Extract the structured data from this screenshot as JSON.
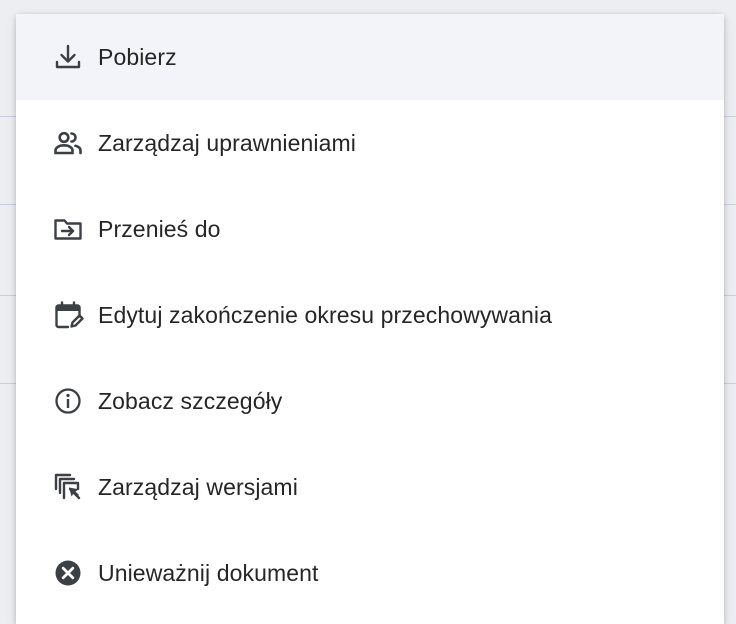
{
  "menu": {
    "items": [
      {
        "label": "Pobierz",
        "icon": "download-icon",
        "highlighted": true
      },
      {
        "label": "Zarządzaj uprawnieniami",
        "icon": "people-icon"
      },
      {
        "label": "Przenieś do",
        "icon": "move-to-folder-icon"
      },
      {
        "label": "Edytuj zakończenie okresu przechowywania",
        "icon": "calendar-edit-icon"
      },
      {
        "label": "Zobacz szczegóły",
        "icon": "info-icon"
      },
      {
        "label": "Zarządzaj wersjami",
        "icon": "versions-icon"
      },
      {
        "label": "Unieważnij dokument",
        "icon": "cancel-circle-icon"
      }
    ]
  },
  "colors": {
    "text": "#262626",
    "icon": "#3c3f44",
    "highlight": "#f3f4f9",
    "background": "#eceef2"
  }
}
